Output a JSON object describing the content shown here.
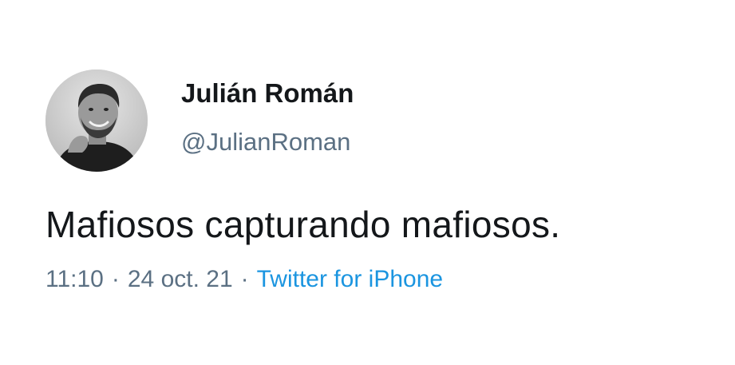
{
  "author": {
    "display_name": "Julián Román",
    "handle": "@JulianRoman",
    "avatar_icon": "profile-photo"
  },
  "tweet": {
    "text": "Mafiosos capturando mafiosos.",
    "time": "11:10",
    "separator": "·",
    "date": "24 oct. 21",
    "source": "Twitter for iPhone"
  },
  "colors": {
    "text": "#14171a",
    "secondary": "#5b7083",
    "link": "#1b95e0"
  }
}
